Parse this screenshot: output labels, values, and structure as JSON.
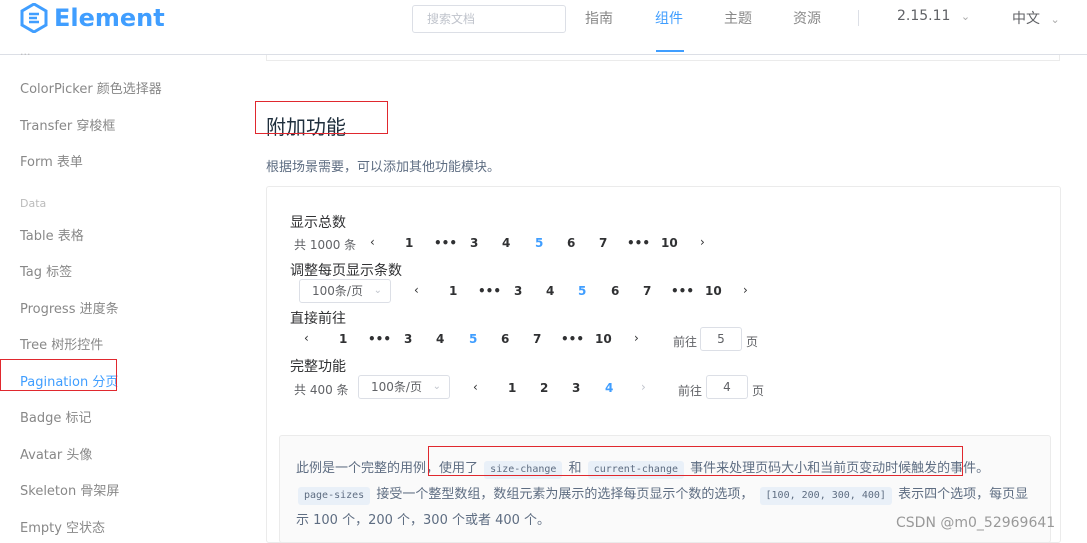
{
  "header": {
    "logo_text": "Element",
    "search_placeholder": "搜索文档",
    "nav": [
      "指南",
      "组件",
      "主题",
      "资源"
    ],
    "version": "2.15.11",
    "language": "中文"
  },
  "sidebar": {
    "partial_top": "...",
    "items": [
      "ColorPicker 颜色选择器",
      "Transfer 穿梭框",
      "Form 表单"
    ],
    "group_data": "Data",
    "data_items": [
      "Table 表格",
      "Tag 标签",
      "Progress 进度条",
      "Tree 树形控件",
      "Pagination 分页",
      "Badge 标记",
      "Avatar 头像",
      "Skeleton 骨架屏",
      "Empty 空状态"
    ]
  },
  "section": {
    "title": "附加功能",
    "desc": "根据场景需要，可以添加其他功能模块。"
  },
  "demos": {
    "total": {
      "label": "显示总数",
      "total_text": "共 1000 条",
      "pages": [
        "1",
        "3",
        "4",
        "5",
        "6",
        "7",
        "10"
      ],
      "active": "5"
    },
    "sizes": {
      "label": "调整每页显示条数",
      "select": "100条/页",
      "pages": [
        "1",
        "3",
        "4",
        "5",
        "6",
        "7",
        "10"
      ],
      "active": "5"
    },
    "jumper": {
      "label": "直接前往",
      "pages": [
        "1",
        "3",
        "4",
        "5",
        "6",
        "7",
        "10"
      ],
      "active": "5",
      "goto_prefix": "前往",
      "goto_value": "5",
      "goto_suffix": "页"
    },
    "full": {
      "label": "完整功能",
      "total_text": "共 400 条",
      "select": "100条/页",
      "pages": [
        "1",
        "2",
        "3",
        "4"
      ],
      "active": "4",
      "goto_prefix": "前往",
      "goto_value": "4",
      "goto_suffix": "页"
    }
  },
  "description": {
    "p1": "此例是一个完整的用例，",
    "p2": "使用了",
    "code1": "size-change",
    "p3": "和",
    "code2": "current-change",
    "p4": "事件来处理页码大小和当前页变动时候触发的事件。",
    "code3": "page-sizes",
    "p5": "接受一个整型数组，数组元素为展示的选择每页显示个数的选项，",
    "code4": "[100, 200, 300, 400]",
    "p6": "表示四个选项，每页显示 100 个，200 个，300 个或者 400 个。"
  },
  "watermark": "CSDN @m0_52969641",
  "glyphs": {
    "prev": "‹",
    "next": "›",
    "dots": "•••",
    "chevron": "⌄"
  },
  "colors": {
    "accent": "#409eff",
    "annotation": "#e0282e"
  }
}
